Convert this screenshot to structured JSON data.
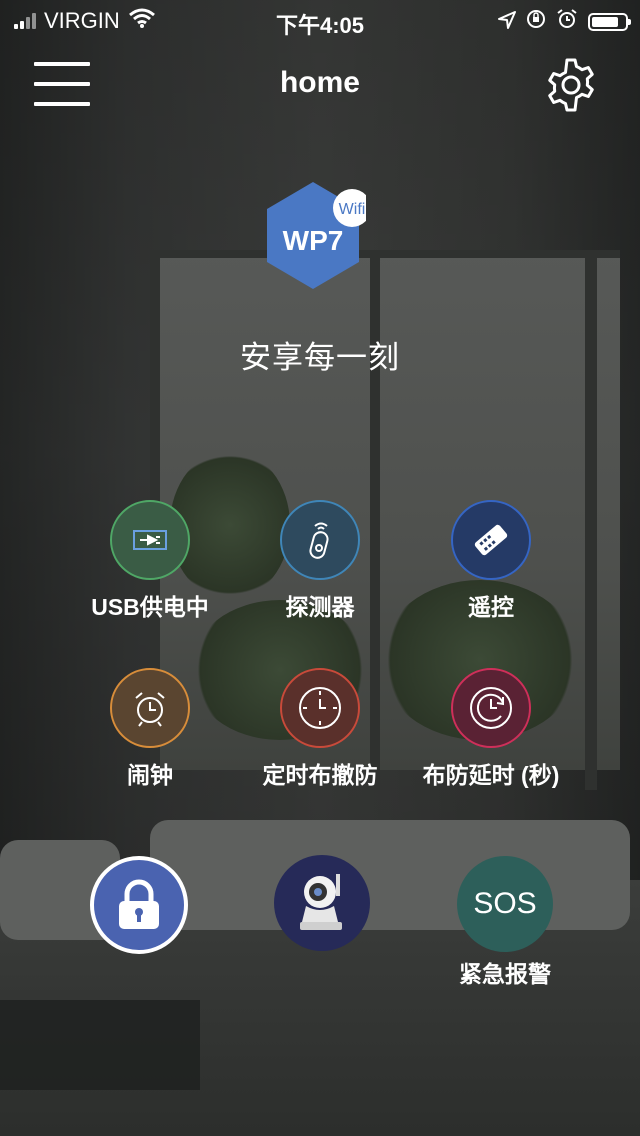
{
  "status_bar": {
    "carrier": "VIRGIN",
    "time": "下午4:05",
    "icons": [
      "signal-icon",
      "wifi-icon",
      "location-icon",
      "rotation-lock-icon",
      "alarm-icon",
      "battery-icon"
    ],
    "battery_level": 0.8
  },
  "header": {
    "menu_icon": "hamburger-menu-icon",
    "title": "home",
    "settings_icon": "gear-icon"
  },
  "logo": {
    "text": "WP7",
    "badge": "Wifi",
    "color": "#4a78c4"
  },
  "tagline": "安享每一刻",
  "features": [
    {
      "label": "USB供电中",
      "icon": "usb-power-icon",
      "ring_color": "#4fa766",
      "fill_color": "#3a5c45"
    },
    {
      "label": "探测器",
      "icon": "detector-remote-icon",
      "ring_color": "#3f86b8",
      "fill_color": "#2e4a5e"
    },
    {
      "label": "遥控",
      "icon": "remote-control-icon",
      "ring_color": "#3565c4",
      "fill_color": "#253a66"
    },
    {
      "label": "闹钟",
      "icon": "alarm-clock-icon",
      "ring_color": "#d88d3a",
      "fill_color": "#5a4530"
    },
    {
      "label": "定时布撤防",
      "icon": "timer-clock-icon",
      "ring_color": "#c94a3a",
      "fill_color": "#5a302b"
    },
    {
      "label": "布防延时 (秒)",
      "icon": "delay-clock-icon",
      "ring_color": "#cf2f5a",
      "fill_color": "#5a2234"
    }
  ],
  "bottom": {
    "lock_icon": "padlock-icon",
    "lock_color": "#4a63b0",
    "camera_icon": "security-camera-icon",
    "camera_color": "#262a58",
    "sos_text": "SOS",
    "sos_label": "紧急报警",
    "sos_color": "#2d5f5a"
  }
}
